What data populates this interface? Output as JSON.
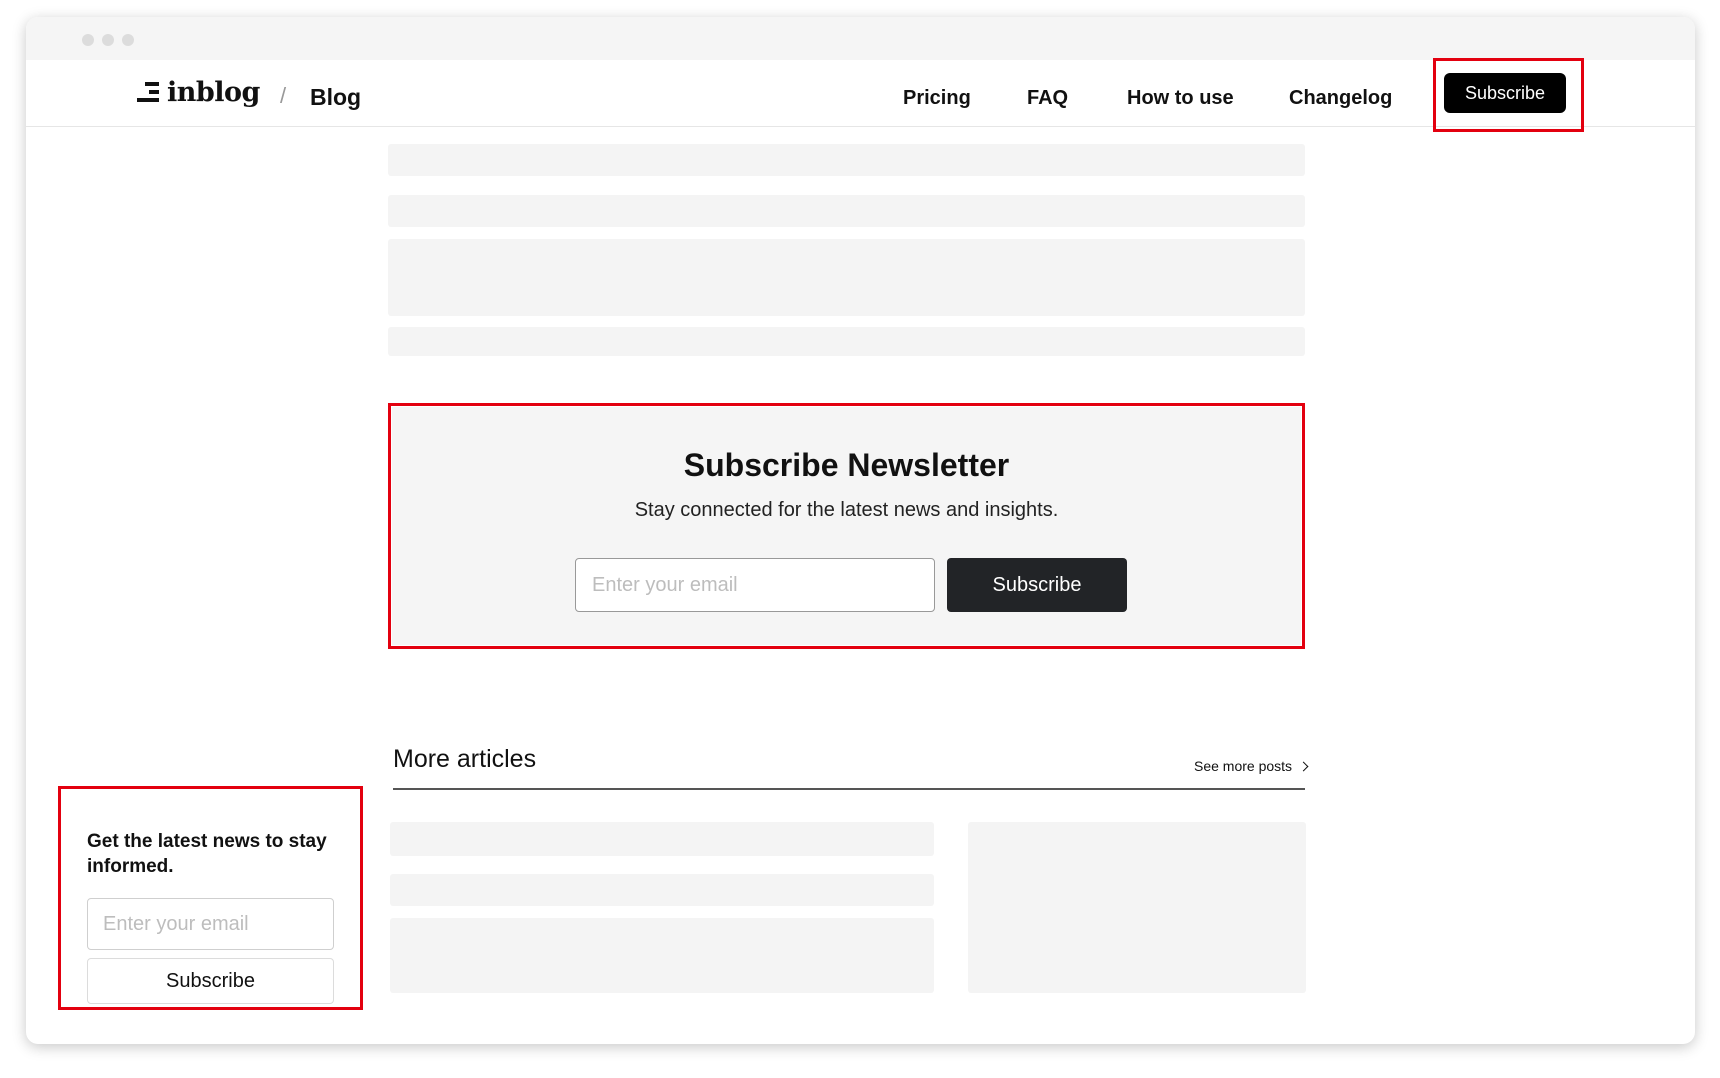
{
  "brand": {
    "logo_text": "inblog",
    "separator": "/",
    "section": "Blog"
  },
  "nav": {
    "links": [
      "Pricing",
      "FAQ",
      "How to use",
      "Changelog"
    ],
    "subscribe_label": "Subscribe"
  },
  "newsletter": {
    "title": "Subscribe Newsletter",
    "subtitle": "Stay connected for the latest news and insights.",
    "email_placeholder": "Enter your email",
    "button_label": "Subscribe"
  },
  "more_articles": {
    "title": "More articles",
    "see_more": "See more posts"
  },
  "sidebar_widget": {
    "title": "Get the latest news to stay informed.",
    "email_placeholder": "Enter your email",
    "button_label": "Subscribe"
  },
  "colors": {
    "highlight": "#e3000f",
    "primary_button": "#000000",
    "newsletter_button": "#222427",
    "skeleton": "#f4f4f4"
  }
}
